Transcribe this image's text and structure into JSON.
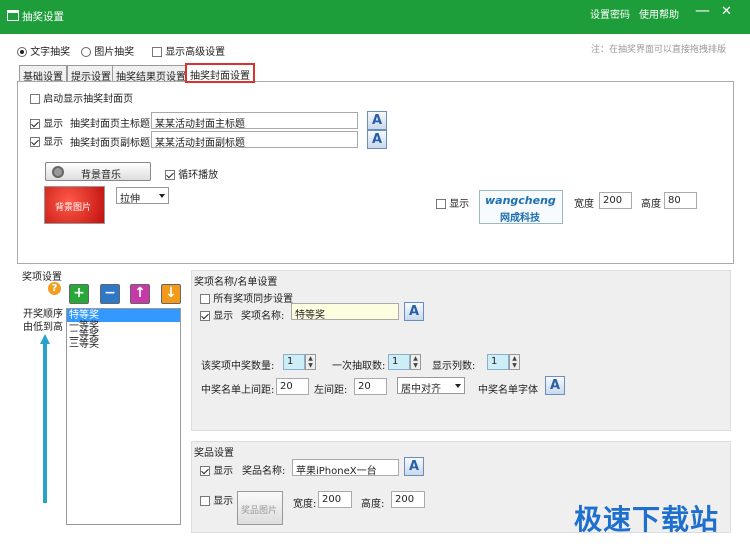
{
  "window": {
    "title": "抽奖设置",
    "links": [
      "设置密码",
      "使用帮助"
    ],
    "minimize": "—",
    "close": "✕"
  },
  "mode": {
    "text": "文字抽奖",
    "image": "图片抽奖",
    "advanced": "显示高级设置",
    "note": "注：在抽奖界面可以直接拖拽排版"
  },
  "tabs": [
    "基础设置",
    "提示设置",
    "抽奖结果页设置",
    "抽奖封面设置"
  ],
  "cover": {
    "enable": "启动显示抽奖封面页",
    "show": "显示",
    "main_title_label": "抽奖封面页主标题",
    "main_title_value": "某某活动封面主标题",
    "sub_title_label": "抽奖封面页副标题",
    "sub_title_value": "某某活动封面副标题",
    "font_glyph": "A",
    "music_btn": "背景音乐",
    "loop": "循环播放",
    "bg_image_label": "背景图片",
    "stretch": "拉伸",
    "logo_show": "显示",
    "logo_text_top": "wangcheng",
    "logo_text_bottom": "网成科技",
    "width_label": "宽度",
    "width_value": "200",
    "height_label": "高度",
    "height_value": "80"
  },
  "prize": {
    "section": "奖项设置",
    "order_label": "开奖顺序由低到高",
    "items": [
      "特等奖",
      "一等奖",
      "二等奖",
      "三等奖"
    ],
    "buttons": [
      "+",
      "−",
      "↑",
      "↓"
    ]
  },
  "list": {
    "section": "奖项名称/名单设置",
    "sync": "所有奖项同步设置",
    "show": "显示",
    "name_label": "奖项名称:",
    "name_value": "特等奖",
    "count_label": "该奖项中奖数量:",
    "count_value": "1",
    "per_draw_label": "一次抽取数:",
    "per_draw_value": "1",
    "cols_label": "显示列数:",
    "cols_value": "1",
    "top_margin_label": "中奖名单上间距:",
    "top_margin_value": "20",
    "left_margin_label": "左间距:",
    "left_margin_value": "20",
    "align": "居中对齐",
    "font_label": "中奖名单字体"
  },
  "award": {
    "section": "奖品设置",
    "show": "显示",
    "name_label": "奖品名称:",
    "name_value": "苹果iPhoneX一台",
    "show2": "显示",
    "image_btn": "奖品图片",
    "width_label": "宽度:",
    "width_value": "200",
    "height_label": "高度:",
    "height_value": "200"
  },
  "watermark": "极速下载站"
}
